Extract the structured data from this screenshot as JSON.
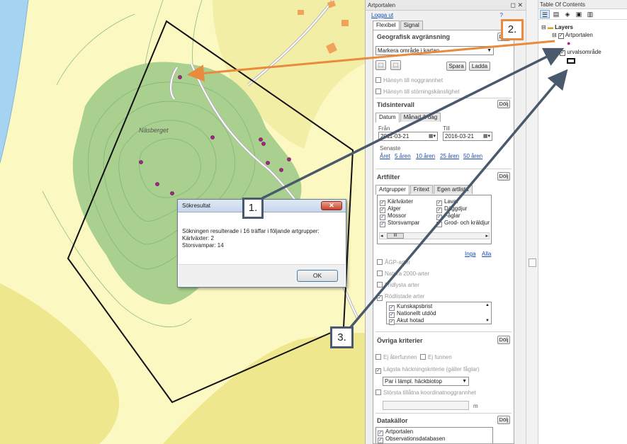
{
  "map": {
    "place_label": "Näsberget"
  },
  "panel": {
    "title": "Artportalen",
    "title_buttons": "◻ ✕",
    "logout": "Logga ut",
    "help": "?",
    "tabs": [
      "Flexibel",
      "Signal"
    ],
    "geo": {
      "title": "Geografisk avgränsning",
      "hide": "Dölj",
      "select_value": "Markera område i kartan",
      "save": "Spara",
      "load": "Ladda",
      "checks": [
        "Hänsyn till noggrannhet",
        "Hänsyn till störningskänslighet"
      ]
    },
    "time": {
      "title": "Tidsintervall",
      "hide": "Dölj",
      "tabs": [
        "Datum",
        "Månad & dag"
      ],
      "from_label": "Från",
      "to_label": "Till",
      "from_value": "2011-03-21",
      "to_value": "2016-03-21",
      "latest_label": "Senaste",
      "latest_links": [
        "Året",
        "5 åren",
        "10 åren",
        "25 åren",
        "50 åren"
      ]
    },
    "species": {
      "title": "Artfilter",
      "hide": "Dölj",
      "tabs": [
        "Artgrupper",
        "Fritext",
        "Egen artlista"
      ],
      "groups": [
        "Kärlväxter",
        "Lavar",
        "Alger",
        "Däggdjur",
        "Mossor",
        "Fåglar",
        "Storsvampar",
        "Grod- och kräldjur"
      ],
      "scroll_thumb": "III",
      "none_link": "Inga",
      "all_link": "Alla",
      "checks": [
        "ÅGP-arter",
        "Natura 2000-arter",
        "Fridlysta arter",
        "Rödlistade arter"
      ],
      "redlist": [
        "Kunskapsbrist",
        "Nationellt utdöd",
        "Akut hotad"
      ]
    },
    "other": {
      "title": "Övriga kriterier",
      "hide": "Dölj",
      "not_found": "Ej återfunnen",
      "found": "Ej funnen",
      "breeding": "Lägsta häckningskriterie (gäller fåglar)",
      "breeding_select": "Par i lämpl. häckbiotop",
      "max_coord": "Största tillåtna koordinatnoggrannhet",
      "unit": "m"
    },
    "sources": {
      "title": "Datakällor",
      "hide": "Dölj",
      "items": [
        "Artportalen",
        "Observationsdatabasen"
      ]
    }
  },
  "toc": {
    "title": "Table Of Contents",
    "layers_label": "Layers",
    "layer1": "Artportalen",
    "layer2": "urvalsområde"
  },
  "dialog": {
    "title": "Sökresultat",
    "close": "✕",
    "line1": "Sökningen resulterade i 16 träffar i följande artgrupper:",
    "line2": "Kärlväxter: 2",
    "line3": "Storsvampar: 14",
    "ok": "OK"
  },
  "callouts": {
    "c1": "1.",
    "c2": "2.",
    "c3": "3."
  },
  "colors": {
    "map_yellow": "#fbf8c2",
    "map_dark_yellow": "#eee78e",
    "map_green": "#a9d08e",
    "map_water": "#a5d4f2",
    "orange_arrow": "#e98a3c",
    "dark_arrow": "#4a5a6c",
    "points": "#b0208e"
  }
}
